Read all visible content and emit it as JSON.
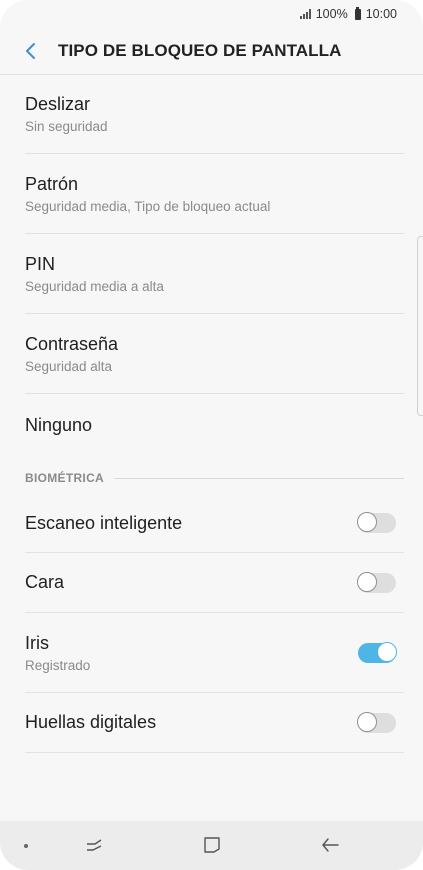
{
  "status_bar": {
    "battery_level": "100%",
    "time": "10:00"
  },
  "header": {
    "title": "TIPO DE BLOQUEO DE PANTALLA"
  },
  "lock_types": [
    {
      "title": "Deslizar",
      "subtitle": "Sin seguridad"
    },
    {
      "title": "Patrón",
      "subtitle": "Seguridad media, Tipo de bloqueo actual"
    },
    {
      "title": "PIN",
      "subtitle": "Seguridad media a alta"
    },
    {
      "title": "Contraseña",
      "subtitle": "Seguridad alta"
    },
    {
      "title": "Ninguno",
      "subtitle": ""
    }
  ],
  "biometrics": {
    "section_label": "BIOMÉTRICA",
    "items": [
      {
        "title": "Escaneo inteligente",
        "subtitle": "",
        "enabled": false
      },
      {
        "title": "Cara",
        "subtitle": "",
        "enabled": false
      },
      {
        "title": "Iris",
        "subtitle": "Registrado",
        "enabled": true
      },
      {
        "title": "Huellas digitales",
        "subtitle": "",
        "enabled": false
      }
    ]
  },
  "colors": {
    "toggle_on": "#4fb4e6",
    "toggle_off": "#dedede",
    "back_arrow": "#3a8fd8"
  },
  "icons": {
    "back": "chevron-left-icon",
    "signal": "signal-icon",
    "battery": "battery-icon",
    "nav_recent": "recent-apps-icon",
    "nav_home": "home-icon",
    "nav_back": "back-arrow-icon"
  }
}
